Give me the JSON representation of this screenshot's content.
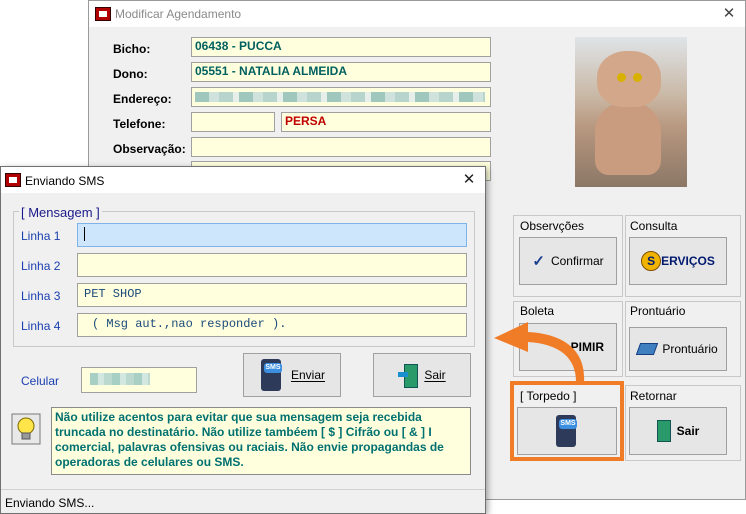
{
  "main_window": {
    "title": "Modificar Agendamento",
    "close": "✕",
    "fields": {
      "bicho_label": "Bicho:",
      "bicho_value": "06438 - PUCCA",
      "dono_label": "Dono:",
      "dono_value": "05551 - NATALIA ALMEIDA",
      "endereco_label": "Endereço:",
      "telefone_label": "Telefone:",
      "raca_value": "PERSA",
      "observacao_label": "Observação:"
    },
    "groups": {
      "observacoes_title": "Observções",
      "confirmar_label": "Confirmar",
      "consulta_title": "Consulta",
      "servicos_label": "ERVIÇOS",
      "servicos_initial": "S",
      "boleta_title": "Boleta",
      "imprimir_label": "PIMIR",
      "prontuario_title": "Prontuário",
      "prontuario_label": "Prontuário",
      "torpedo_title": "[ Torpedo ]",
      "retornar_title": "Retornar",
      "sair_label": "Sair"
    }
  },
  "sms_dialog": {
    "title": "Enviando SMS",
    "close": "✕",
    "mensagem_title": "[ Mensagem ]",
    "lines": [
      {
        "label": "Linha 1",
        "value": ""
      },
      {
        "label": "Linha 2",
        "value": ""
      },
      {
        "label": "Linha 3",
        "value": "PET SHOP"
      },
      {
        "label": "Linha 4",
        "value": "( Msg aut.,nao responder )."
      }
    ],
    "celular_label": "Celular",
    "enviar_label": "Enviar",
    "sair_label": "Sair",
    "warning": "Não utilize acentos para evitar que sua mensagem seja recebida truncada no destinatário. Não utilize tambéem [ $ ] Cifrão ou [ & ] I comercial, palavras ofensivas ou raciais. Não envie propagandas de operadoras de celulares ou SMS.",
    "status": "Enviando SMS...",
    "sms_icon_text": "SMS"
  },
  "colors": {
    "highlight": "#f07c28",
    "field_bg": "#ffffdd",
    "label_blue": "#1a3fb0",
    "warning_text": "#007070"
  }
}
